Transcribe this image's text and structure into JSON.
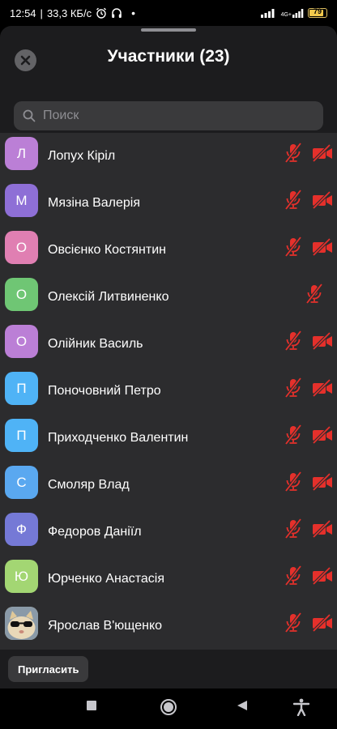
{
  "status_bar": {
    "time": "12:54",
    "speed": "33,3 КБ/с",
    "network": "4G+",
    "battery": "79"
  },
  "header": {
    "title": "Участники (23)"
  },
  "search": {
    "placeholder": "Поиск"
  },
  "participants": [
    {
      "initial": "Л",
      "name": "Лопух Кіріл",
      "color": "#bb7fd6",
      "camera_off": true
    },
    {
      "initial": "М",
      "name": "Мязіна Валерія",
      "color": "#8e6fd6",
      "camera_off": true
    },
    {
      "initial": "О",
      "name": "Овсієнко Костянтин",
      "color": "#e07fb2",
      "camera_off": true
    },
    {
      "initial": "О",
      "name": "Олексій Литвиненко",
      "color": "#6fc674",
      "camera_off": false
    },
    {
      "initial": "О",
      "name": "Олійник Василь",
      "color": "#bb7fd6",
      "camera_off": true
    },
    {
      "initial": "П",
      "name": "Поночовний Петро",
      "color": "#4fb3f6",
      "camera_off": true
    },
    {
      "initial": "П",
      "name": "Приходченко Валентин",
      "color": "#4fb3f6",
      "camera_off": true
    },
    {
      "initial": "С",
      "name": "Смоляр Влад",
      "color": "#5aa8f0",
      "camera_off": true
    },
    {
      "initial": "Ф",
      "name": "Федоров Даніїл",
      "color": "#7579d6",
      "camera_off": true
    },
    {
      "initial": "Ю",
      "name": "Юрченко Анастасія",
      "color": "#a3d673",
      "camera_off": true
    },
    {
      "initial": "",
      "name": "Ярослав В'ющенко",
      "color": "#c9b48a",
      "camera_off": true,
      "photo": "cat-sunglasses"
    }
  ],
  "footer": {
    "invite_label": "Пригласить"
  },
  "colors": {
    "muted_red": "#e5302b",
    "sheet_bg": "#1c1c1e",
    "list_bg": "#2c2c2e"
  },
  "nav_icons": [
    "recent-apps-icon",
    "home-icon",
    "back-icon",
    "accessibility-icon"
  ]
}
